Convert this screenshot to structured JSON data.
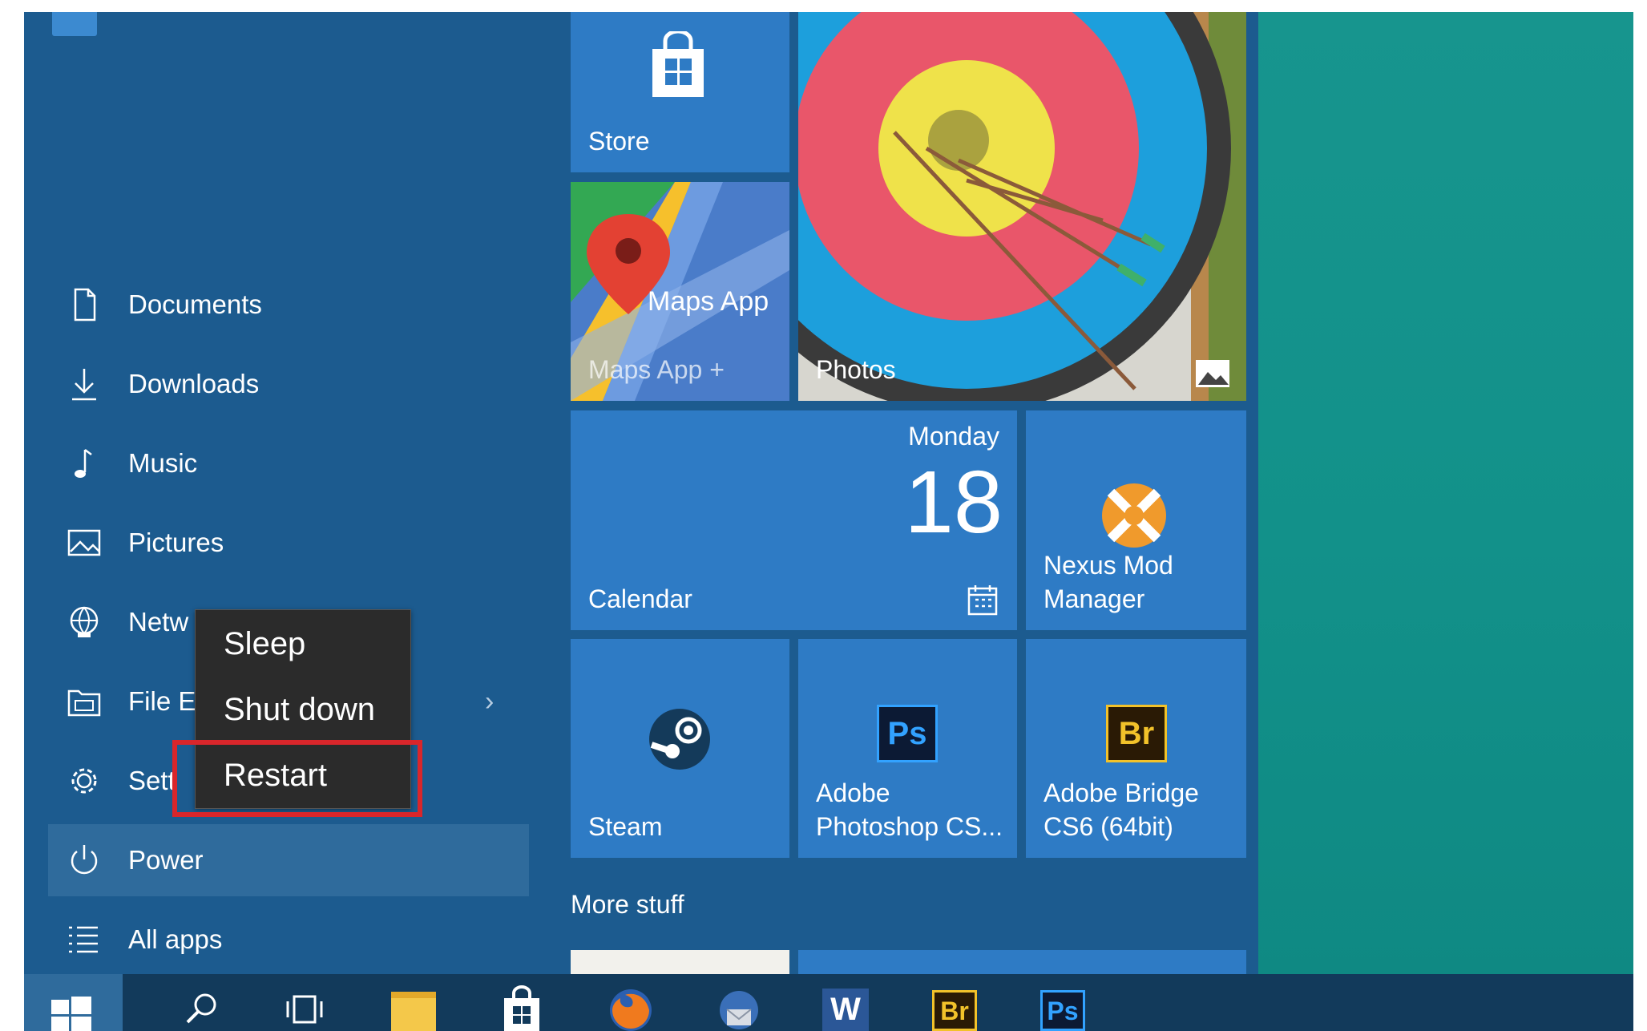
{
  "nav": {
    "items": [
      {
        "label": "Documents",
        "icon": "document-icon"
      },
      {
        "label": "Downloads",
        "icon": "download-icon"
      },
      {
        "label": "Music",
        "icon": "music-icon"
      },
      {
        "label": "Pictures",
        "icon": "pictures-icon"
      },
      {
        "label": "Netw",
        "icon": "network-icon"
      },
      {
        "label": "File E",
        "icon": "file-explorer-icon"
      },
      {
        "label": "Sett",
        "icon": "gear-icon"
      },
      {
        "label": "Power",
        "icon": "power-icon"
      },
      {
        "label": "All apps",
        "icon": "list-icon"
      }
    ],
    "chevron": "›"
  },
  "power_menu": {
    "items": [
      "Sleep",
      "Shut down",
      "Restart"
    ]
  },
  "tiles": {
    "store": "Store",
    "maps_title": "Maps App",
    "maps_sub": "Maps App +",
    "photos": "Photos",
    "calendar_day": "Monday",
    "calendar_date": "18",
    "calendar": "Calendar",
    "nexus_line1": "Nexus Mod",
    "nexus_line2": "Manager",
    "steam": "Steam",
    "ps_line1": "Adobe",
    "ps_line2": "Photoshop CS...",
    "ps_badge": "Ps",
    "br_line1": "Adobe Bridge",
    "br_line2": "CS6 (64bit)",
    "br_badge": "Br"
  },
  "group_label": "More stuff",
  "taskbar": {
    "br": "Br",
    "ps": "Ps",
    "word": "W"
  },
  "colors": {
    "start_bg": "#1c5b8f",
    "tile_blue": "#2e7bc5",
    "wallpaper": "#13948d",
    "highlight": "#d9262b"
  }
}
